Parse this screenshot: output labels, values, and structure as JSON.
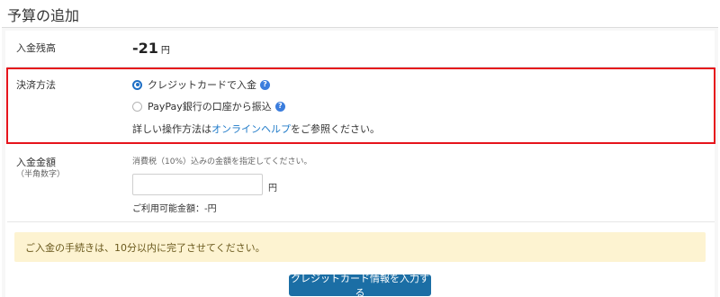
{
  "page": {
    "title": "予算の追加"
  },
  "balance": {
    "label": "入金残高",
    "value": "-21",
    "unit": "円"
  },
  "payment_method": {
    "label": "決済方法",
    "options": [
      {
        "label": "クレジットカードで入金",
        "selected": true
      },
      {
        "label": "PayPay銀行の口座から振込",
        "selected": false
      }
    ],
    "help_prefix": "詳しい操作方法は",
    "help_link": "オンラインヘルプ",
    "help_suffix": "をご参照ください。"
  },
  "amount": {
    "label": "入金金額",
    "sublabel": "（半角数字）",
    "note": "消費税（10%）込みの金額を指定してください。",
    "value": "",
    "unit": "円",
    "available": "ご利用可能金額：-円"
  },
  "warning": {
    "text": "ご入金の手続きは、10分以内に完了させてください。"
  },
  "actions": {
    "submit_label": "クレジットカード情報を入力する"
  },
  "colors": {
    "accent": "#1b6ea5",
    "highlight_border": "#e6141c",
    "warning_bg": "#fdf3d1"
  }
}
